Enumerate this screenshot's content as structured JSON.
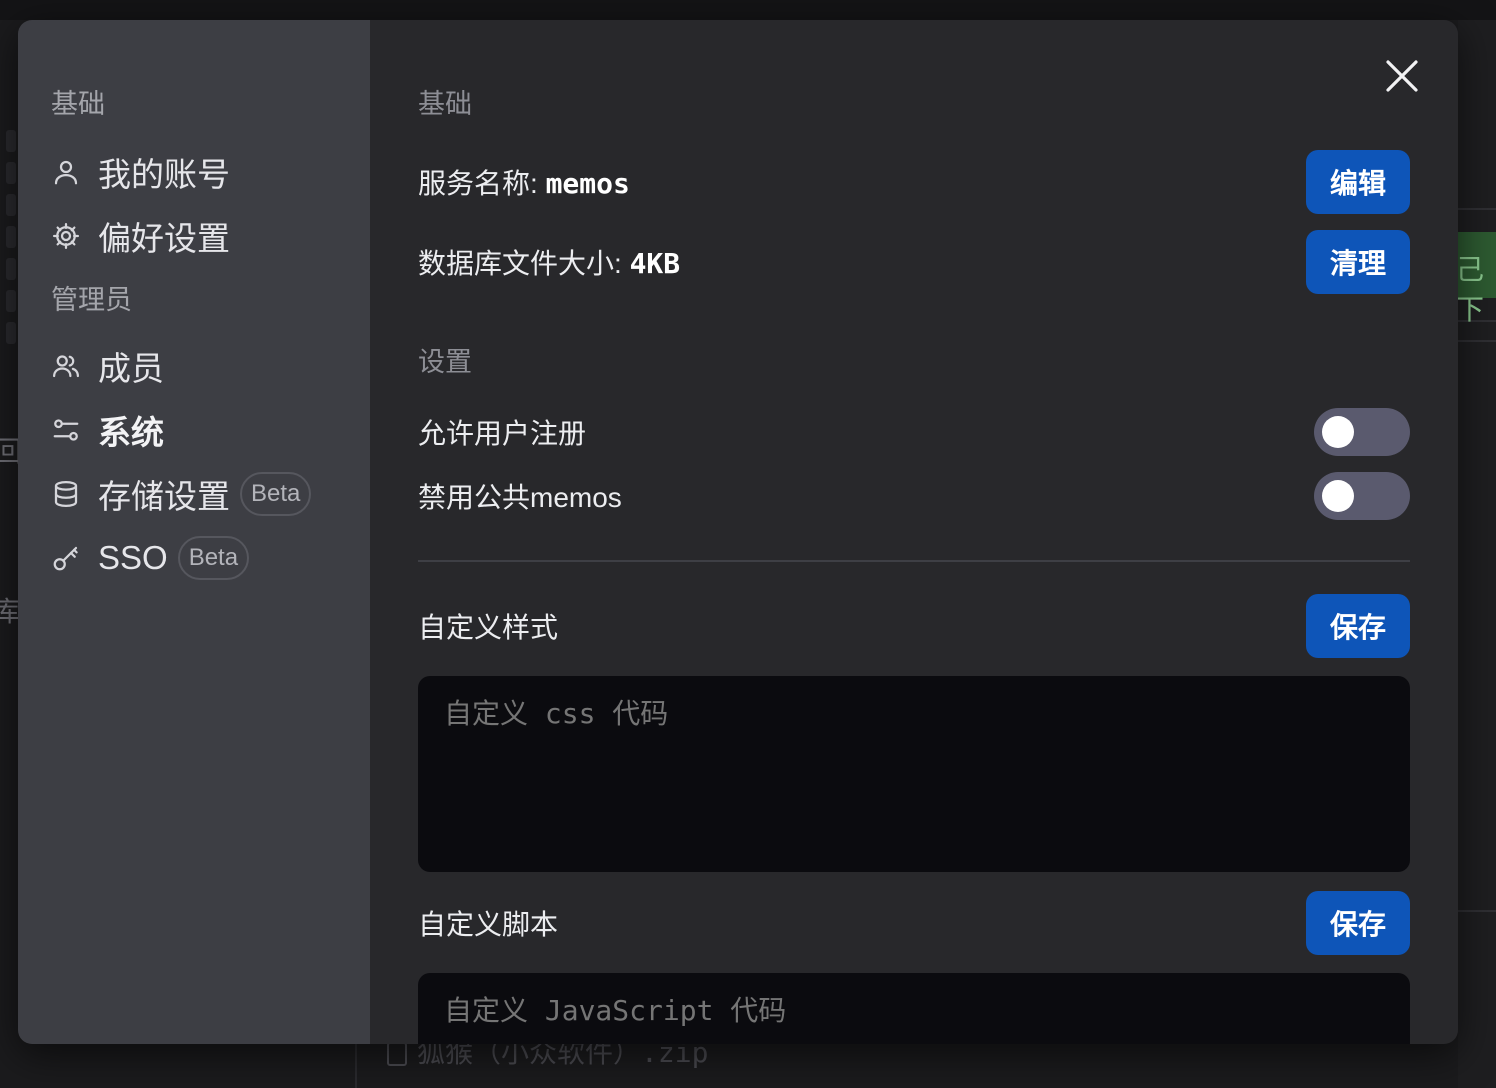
{
  "background": {
    "glyph_left_1": "回",
    "glyph_left_2": "库",
    "glyph_right": "己下",
    "bottom_row_text": "狐猴（小众软件）.zip"
  },
  "sidebar": {
    "section_basic": "基础",
    "item_account": "我的账号",
    "item_preferences": "偏好设置",
    "section_admin": "管理员",
    "item_members": "成员",
    "item_system": "系统",
    "item_storage": "存储设置",
    "item_storage_badge": "Beta",
    "item_sso": "SSO",
    "item_sso_badge": "Beta"
  },
  "content": {
    "section_basic": "基础",
    "service_name_label": "服务名称: ",
    "service_name_value": "memos",
    "edit_button": "编辑",
    "db_size_label": "数据库文件大小: ",
    "db_size_value": "4KB",
    "clean_button": "清理",
    "section_settings": "设置",
    "allow_signup_label": "允许用户注册",
    "allow_signup_enabled": false,
    "disable_public_label": "禁用公共memos",
    "disable_public_enabled": false,
    "custom_style_label": "自定义样式",
    "custom_style_save": "保存",
    "custom_style_placeholder": "自定义 css 代码",
    "custom_script_label": "自定义脚本",
    "custom_script_save": "保存",
    "custom_script_placeholder": "自定义 JavaScript 代码"
  },
  "colors": {
    "primary_button": "#0e55b8",
    "sidebar_bg": "#3d3e44",
    "content_bg": "#28282b",
    "toggle_off": "#5a5a6e"
  }
}
